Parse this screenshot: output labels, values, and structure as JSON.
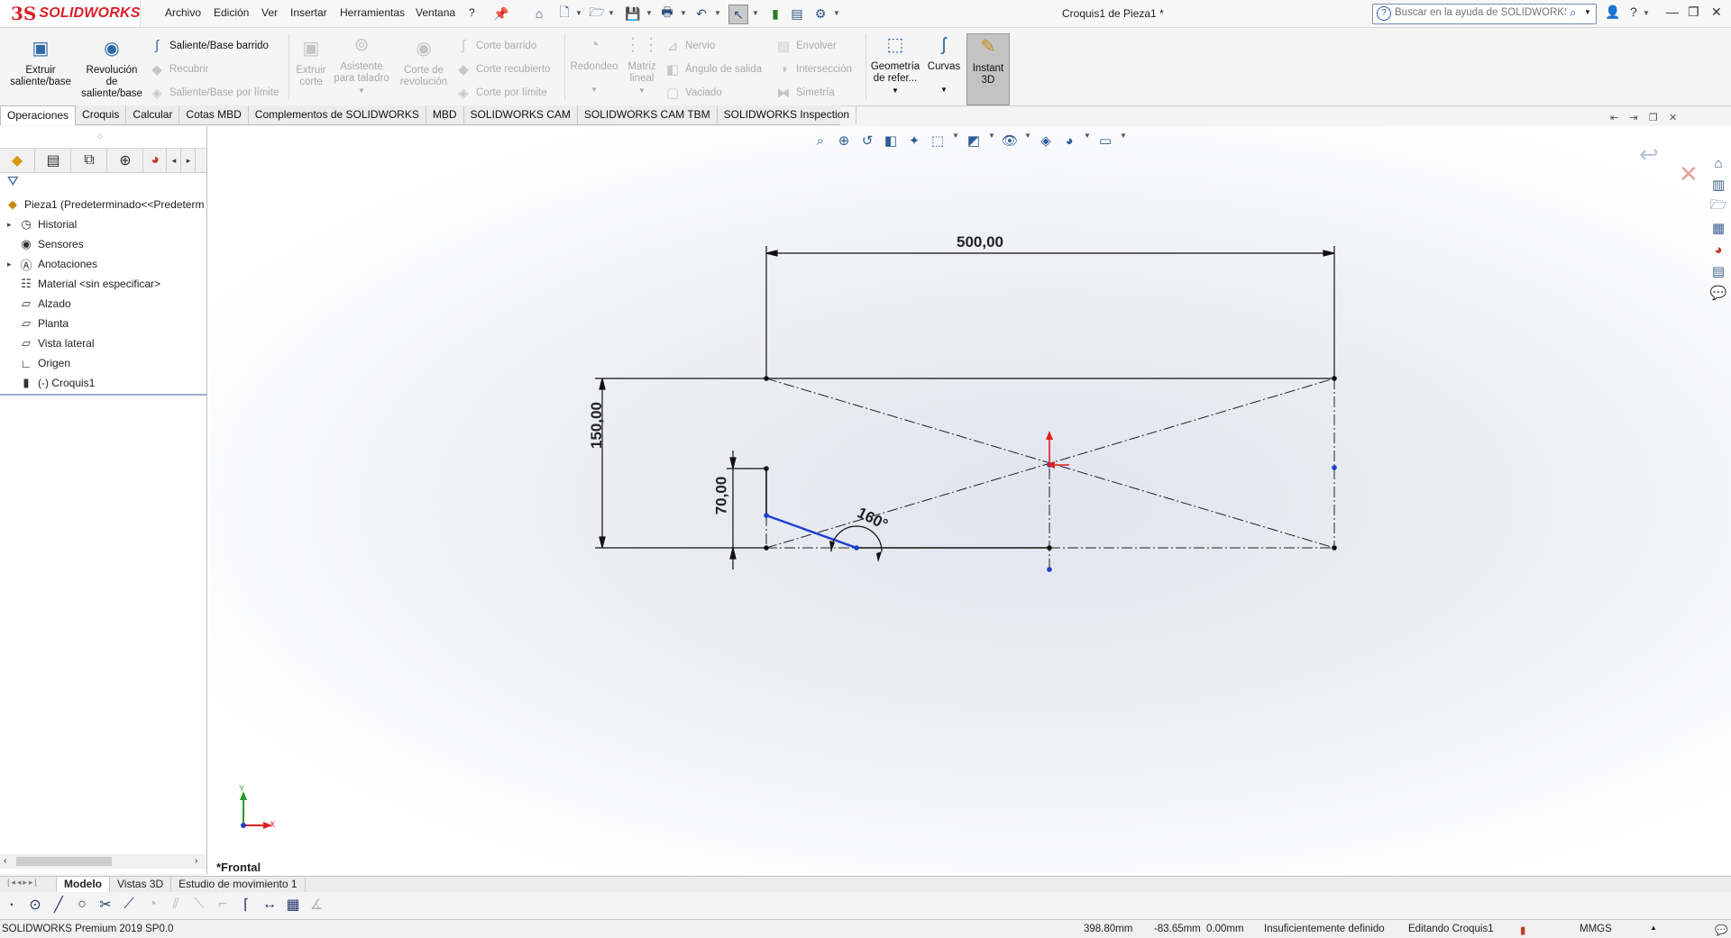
{
  "app": {
    "logo_mark": "3S",
    "logo_text": "SOLIDWORKS",
    "document_title": "Croquis1 de Pieza1 *",
    "help_search_placeholder": "Buscar en la ayuda de SOLIDWORKS"
  },
  "menu": [
    "Archivo",
    "Edición",
    "Ver",
    "Insertar",
    "Herramientas",
    "Ventana",
    "?"
  ],
  "ribbon": {
    "extrude": "Extruir saliente/base",
    "revolve": "Revolución de saliente/base",
    "sweep": "Saliente/Base barrido",
    "loft": "Recubrir",
    "boundary": "Saliente/Base por límite",
    "extruded_cut": "Extruir corte",
    "hole_wizard": "Asistente para taladro",
    "revolved_cut": "Corte de revolución",
    "swept_cut": "Corte barrido",
    "lofted_cut": "Corte recubierto",
    "boundary_cut": "Corte por límite",
    "fillet": "Redondeo",
    "linear_pattern": "Matriz lineal",
    "rib": "Nervio",
    "draft": "Ángulo de salida",
    "shell": "Vaciado",
    "wrap": "Envolver",
    "intersect": "Intersección",
    "mirror": "Simetría",
    "ref_geometry": "Geometría de refer...",
    "curves": "Curvas",
    "instant3d": "Instant 3D"
  },
  "command_tabs": [
    "Operaciones",
    "Croquis",
    "Calcular",
    "Cotas MBD",
    "Complementos de SOLIDWORKS",
    "MBD",
    "SOLIDWORKS CAM",
    "SOLIDWORKS CAM TBM",
    "SOLIDWORKS Inspection"
  ],
  "tree": {
    "root": "Pieza1  (Predeterminado<<Predeterm",
    "items": [
      {
        "label": "Historial",
        "expandable": true
      },
      {
        "label": "Sensores",
        "expandable": false
      },
      {
        "label": "Anotaciones",
        "expandable": true
      },
      {
        "label": "Material <sin especificar>",
        "expandable": false
      },
      {
        "label": "Alzado",
        "expandable": false
      },
      {
        "label": "Planta",
        "expandable": false
      },
      {
        "label": "Vista lateral",
        "expandable": false
      },
      {
        "label": "Origen",
        "expandable": false
      },
      {
        "label": "(-) Croquis1",
        "expandable": false
      }
    ]
  },
  "sketch": {
    "dim_width": "500,00",
    "dim_height": "150,00",
    "dim_vertical": "70,00",
    "dim_angle": "160°"
  },
  "triad": {
    "x": "X",
    "y": "Y"
  },
  "view_label": "*Frontal",
  "bottom_tabs": [
    "Modelo",
    "Vistas 3D",
    "Estudio de movimiento 1"
  ],
  "status": {
    "product": "SOLIDWORKS Premium 2019 SP0.0",
    "x": "398.80mm",
    "y": "-83.65mm",
    "z": "0.00mm",
    "definition": "Insuficientemente definido",
    "mode": "Editando Croquis1",
    "units": "MMGS"
  },
  "colors": {
    "brand": "#d8202a",
    "selection_blue": "#1f3fd1",
    "origin_red": "#e0201d"
  }
}
